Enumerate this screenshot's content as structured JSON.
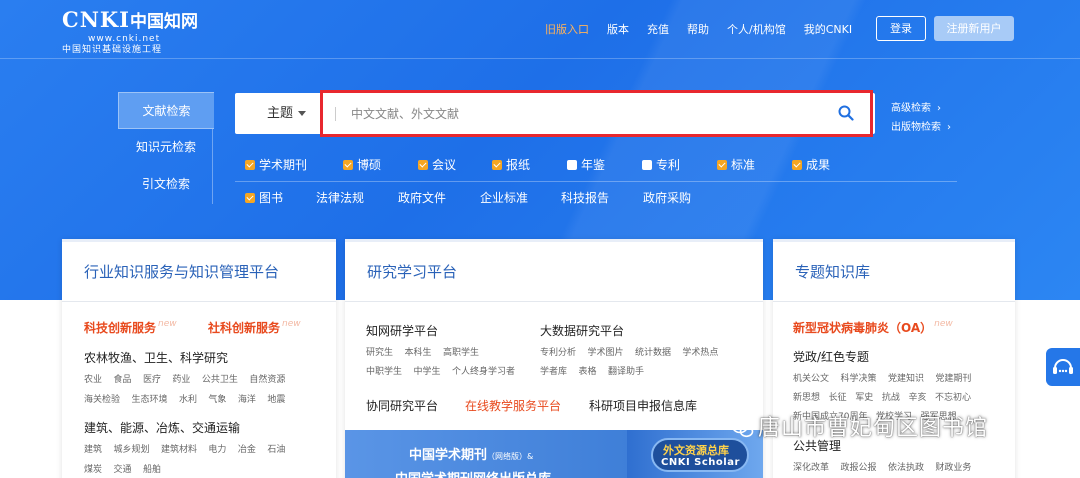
{
  "logo": {
    "mark": "CNKI",
    "mark_cn": "中国知网",
    "url": "www.cnki.net",
    "slogan": "中国知识基础设施工程"
  },
  "topnav": {
    "old_entry": "旧版入口",
    "version": "版本",
    "recharge": "充值",
    "help": "帮助",
    "institution": "个人/机构馆",
    "my": "我的CNKI",
    "login": "登录",
    "register": "注册新用户"
  },
  "search_tabs": [
    "文献检索",
    "知识元检索",
    "引文检索"
  ],
  "search": {
    "scope": "主题",
    "placeholder": "中文文献、外文文献"
  },
  "advanced": {
    "advanced_search": "高级检索",
    "publication_search": "出版物检索",
    "arrow": "›"
  },
  "checkboxes_row1": [
    {
      "label": "学术期刊",
      "checked": true
    },
    {
      "label": "博硕",
      "checked": true
    },
    {
      "label": "会议",
      "checked": true
    },
    {
      "label": "报纸",
      "checked": true
    },
    {
      "label": "年鉴",
      "checked": false
    },
    {
      "label": "专利",
      "checked": false
    },
    {
      "label": "标准",
      "checked": true
    },
    {
      "label": "成果",
      "checked": true
    }
  ],
  "row2": {
    "books": "图书",
    "links": [
      "法律法规",
      "政府文件",
      "企业标准",
      "科技报告",
      "政府采购"
    ]
  },
  "card1": {
    "title": "行业知识服务与知识管理平台",
    "tag1": "科技创新服务",
    "tag2": "社科创新服务",
    "new": "new",
    "sec1": "农林牧渔、卫生、科学研究",
    "sec1_row1": [
      "农业",
      "食品",
      "医疗",
      "药业",
      "公共卫生",
      "自然资源"
    ],
    "sec1_row2": [
      "海关检验",
      "生态环境",
      "水利",
      "气象",
      "海洋",
      "地震"
    ],
    "sec2": "建筑、能源、冶炼、交通运输",
    "sec2_row1": [
      "建筑",
      "城乡规划",
      "建筑材料",
      "电力",
      "冶金",
      "石油"
    ],
    "sec2_row2": [
      "煤炭",
      "交通",
      "船舶"
    ]
  },
  "card2": {
    "title": "研究学习平台",
    "left_title": "知网研学平台",
    "left_row1": [
      "研究生",
      "本科生",
      "高职学生"
    ],
    "left_row2": [
      "中职学生",
      "中学生",
      "个人终身学习者"
    ],
    "right_title": "大数据研究平台",
    "right_row1": [
      "专利分析",
      "学术图片",
      "统计数据",
      "学术热点"
    ],
    "right_row2": [
      "学者库",
      "表格",
      "翻译助手"
    ],
    "collab": "协同研究平台",
    "online": "在线教学服务平台",
    "project": "科研项目申报信息库",
    "banner_l1": "中国学术期刊",
    "banner_l1_small": "（网络版）&",
    "banner_l2": "中国学术期刊网络出版总库",
    "banner_r1": "外文资源总库",
    "banner_r2": "CNKI Scholar"
  },
  "card3": {
    "title": "专题知识库",
    "covid": "新型冠状病毒肺炎（OA）",
    "new": "new",
    "sec1": "党政/红色专题",
    "row1": [
      "机关公文",
      "科学决策",
      "党建知识",
      "党建期刊"
    ],
    "row2": [
      "新思想",
      "长征",
      "军史",
      "抗战",
      "辛亥",
      "不忘初心"
    ],
    "row3": [
      "新中国成立70周年",
      "党校学习",
      "强军思想"
    ],
    "sec2": "公共管理",
    "row4": [
      "深化改革",
      "政报公报",
      "依法执政",
      "财政业务"
    ]
  },
  "watermark": "唐山市曹妃甸区图书馆",
  "colors": {
    "banner": "#1e6fe8",
    "highlight": "#e8282e",
    "accent_orange": "#f5a623",
    "title_blue": "#2a62b8",
    "red_text": "#e84a1e"
  }
}
